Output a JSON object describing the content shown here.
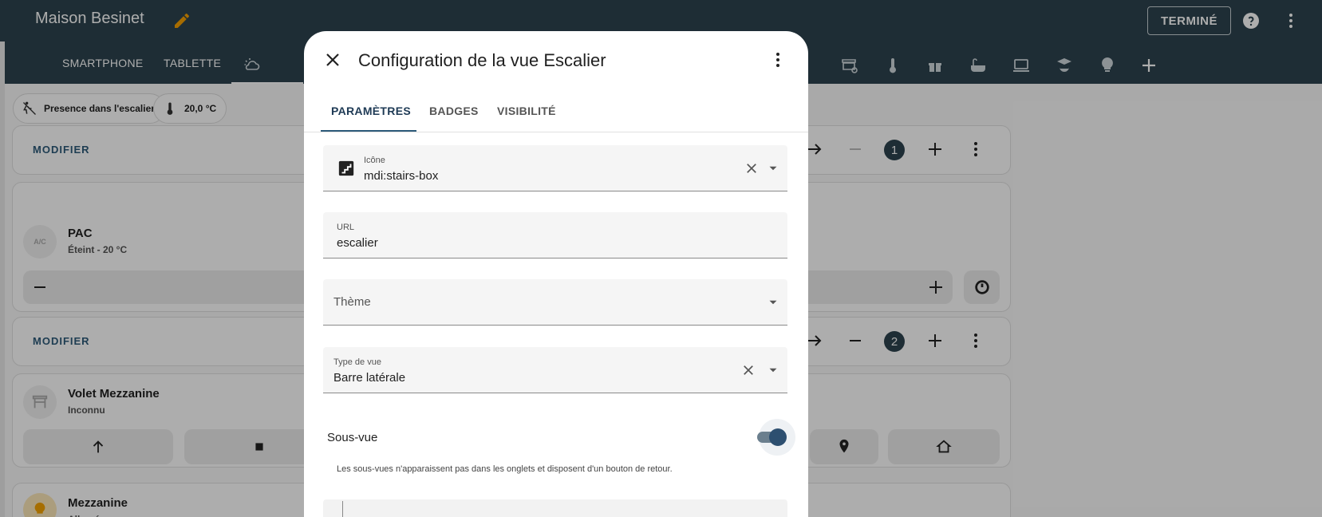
{
  "header": {
    "title": "Maison Besinet",
    "done_label": "TERMINÉ",
    "tabs": [
      "SMARTPHONE",
      "TABLETTE"
    ],
    "view_icons": [
      "weather-partly-cloudy-icon",
      "motion-sensor-off-icon",
      "garage-icon",
      "thermometer-icon",
      "gift-icon",
      "bathtub-icon",
      "laptop-icon",
      "account-school-icon",
      "lightbulb-icon",
      "plus-icon"
    ]
  },
  "badges": [
    {
      "label": "Presence dans l'escalier",
      "icon": "motion-sensor-off-icon"
    },
    {
      "label": "20,0 °C",
      "icon": "thermometer-icon"
    }
  ],
  "sections": [
    {
      "modify_label": "MODIFIER",
      "number": "1"
    },
    {
      "modify_label": "MODIFIER",
      "number": "2"
    }
  ],
  "cards": {
    "pac": {
      "name": "PAC",
      "state": "Éteint - 20 °C",
      "icon_text": "A/C"
    },
    "volet": {
      "name": "Volet Mezzanine",
      "state": "Inconnu"
    },
    "mezzanine": {
      "name": "Mezzanine",
      "state": "Allumé"
    }
  },
  "dialog": {
    "title": "Configuration de la vue Escalier",
    "tabs": [
      "PARAMÈTRES",
      "BADGES",
      "VISIBILITÉ"
    ],
    "active_tab": "PARAMÈTRES",
    "fields": {
      "icon": {
        "label": "Icône",
        "value": "mdi:stairs-box"
      },
      "url": {
        "label": "URL",
        "value": "escalier"
      },
      "theme": {
        "label": "Thème",
        "value": ""
      },
      "view_type": {
        "label": "Type de vue",
        "value": "Barre latérale"
      }
    },
    "subview": {
      "label": "Sous-vue",
      "enabled": true,
      "helper": "Les sous-vues n'apparaissent pas dans les onglets et disposent d'un bouton de retour."
    }
  },
  "colors": {
    "header_bg": "#2d434e",
    "accent": "#2d5a7a",
    "edit_pencil": "#f59f00"
  }
}
